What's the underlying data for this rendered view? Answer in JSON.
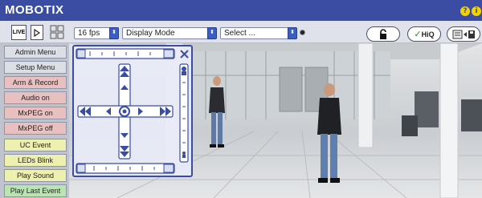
{
  "app": {
    "brand": "MOBOTIX"
  },
  "toolbar": {
    "live_label": "LIVE",
    "fps": "16 fps",
    "display_mode": "Display Mode",
    "select": "Select ...",
    "hiq_label": "HiQ"
  },
  "sidebar": {
    "items": [
      {
        "label": "Admin Menu",
        "color": "#dcdfe6"
      },
      {
        "label": "Setup Menu",
        "color": "#dcdfe6"
      },
      {
        "label": "Arm & Record",
        "color": "#e9c0c0"
      },
      {
        "label": "Audio on",
        "color": "#e9c0c0"
      },
      {
        "label": "MxPEG on",
        "color": "#e9c0c0"
      },
      {
        "label": "MxPEG off",
        "color": "#e9c0c0"
      },
      {
        "label": "UC Event",
        "color": "#eef0b0"
      },
      {
        "label": "LEDs Blink",
        "color": "#eef0b0"
      },
      {
        "label": "Play Sound",
        "color": "#eef0b0"
      },
      {
        "label": "Play Last Event",
        "color": "#b9e6b0"
      }
    ]
  },
  "colors": {
    "title_bar": "#3a4da3",
    "accent": "#3b5ec4",
    "help_icon": "#f2d200"
  }
}
